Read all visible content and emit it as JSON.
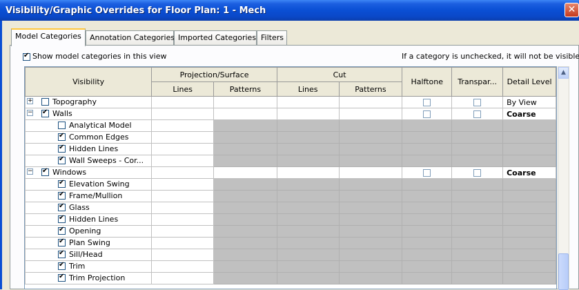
{
  "window": {
    "title": "Visibility/Graphic Overrides for Floor Plan: 1 - Mech",
    "close_icon": "close-icon"
  },
  "tabs": [
    "Model Categories",
    "Annotation Categories",
    "Imported Categories",
    "Filters"
  ],
  "active_tab": "Model Categories",
  "show_model_categories": {
    "label": "Show model categories in this view",
    "checked": true
  },
  "note": "If a category is unchecked, it will not be visible.",
  "table": {
    "headers": {
      "visibility": "Visibility",
      "projection_surface": "Projection/Surface",
      "cut": "Cut",
      "lines": "Lines",
      "patterns": "Patterns",
      "halftone": "Halftone",
      "transparent": "Transpar...",
      "detail_level": "Detail Level"
    },
    "rows": [
      {
        "name": "Topography",
        "expander": "+",
        "checked": false,
        "child": false,
        "halftone": true,
        "transparent": true,
        "detail": "By View",
        "bold": false
      },
      {
        "name": "Walls",
        "expander": "-",
        "checked": true,
        "child": false,
        "halftone": true,
        "transparent": true,
        "detail": "Coarse",
        "bold": true
      },
      {
        "name": "Analytical Model",
        "checked": false,
        "child": true
      },
      {
        "name": "Common Edges",
        "checked": true,
        "child": true
      },
      {
        "name": "Hidden Lines",
        "checked": true,
        "child": true
      },
      {
        "name": "Wall Sweeps - Cor...",
        "checked": true,
        "child": true
      },
      {
        "name": "Windows",
        "expander": "-",
        "checked": true,
        "child": false,
        "halftone": true,
        "transparent": true,
        "detail": "Coarse",
        "bold": true
      },
      {
        "name": "Elevation Swing",
        "checked": true,
        "child": true
      },
      {
        "name": "Frame/Mullion",
        "checked": true,
        "child": true
      },
      {
        "name": "Glass",
        "checked": true,
        "child": true
      },
      {
        "name": "Hidden Lines",
        "checked": true,
        "child": true
      },
      {
        "name": "Opening",
        "checked": true,
        "child": true
      },
      {
        "name": "Plan Swing",
        "checked": true,
        "child": true
      },
      {
        "name": "Sill/Head",
        "checked": true,
        "child": true
      },
      {
        "name": "Trim",
        "checked": true,
        "child": true
      },
      {
        "name": "Trim Projection",
        "checked": true,
        "child": true
      }
    ]
  }
}
